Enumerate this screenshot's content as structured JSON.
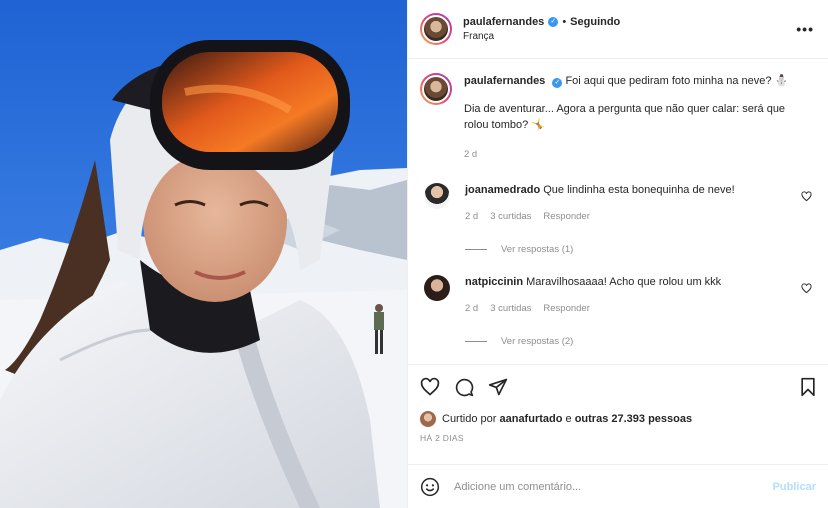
{
  "post": {
    "username": "paulafernandes",
    "follow_status": "Seguindo",
    "location": "França",
    "more_icon": "more-horizontal-icon"
  },
  "caption": {
    "username": "paulafernandes",
    "line1": "Foi aqui que pediram foto minha na neve? ⛄",
    "line2": "Dia de aventurar... Agora a pergunta que não quer calar: será que rolou tombo? 🤸",
    "time": "2 d"
  },
  "comments": [
    {
      "username": "joanamedrado",
      "text": "Que lindinha esta bonequinha de neve!",
      "time": "2 d",
      "likes": "3 curtidas",
      "reply": "Responder",
      "view_replies": "Ver respostas (1)"
    },
    {
      "username": "natpiccinin",
      "text": "Maravilhosaaaa! Acho que rolou um kkk",
      "time": "2 d",
      "likes": "3 curtidas",
      "reply": "Responder",
      "view_replies": "Ver respostas (2)"
    }
  ],
  "likes": {
    "prefix": "Curtido por",
    "user": "aanafurtado",
    "middle": "e",
    "others": "outras 27.393 pessoas"
  },
  "posted_ago": "HÁ 2 DIAS",
  "add_comment": {
    "placeholder": "Adicione um comentário...",
    "publish_label": "Publicar"
  },
  "colors": {
    "accent": "#3897f0",
    "muted": "#8e8e8e",
    "publish_disabled": "#b2dffc"
  }
}
